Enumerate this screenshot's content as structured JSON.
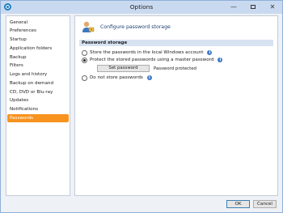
{
  "window": {
    "title": "Options",
    "minimize": "—",
    "close": "✕"
  },
  "sidebar": {
    "items": [
      {
        "label": "General"
      },
      {
        "label": "Preferences"
      },
      {
        "label": "Startup"
      },
      {
        "label": "Application folders"
      },
      {
        "label": "Backup"
      },
      {
        "label": "Filters"
      },
      {
        "label": "Logs and history"
      },
      {
        "label": "Backup on demand"
      },
      {
        "label": "CD, DVD or Blu-ray"
      },
      {
        "label": "Updates"
      },
      {
        "label": "Notifications"
      },
      {
        "label": "Passwords"
      }
    ],
    "selected": "Passwords"
  },
  "content": {
    "heading": "Configure password storage",
    "section_title": "Password storage",
    "options": [
      {
        "label": "Store the passwords in the local Windows account",
        "selected": false
      },
      {
        "label": "Protect the stored passwords using a master password",
        "selected": true
      },
      {
        "label": "Do not store passwords",
        "selected": false
      }
    ],
    "set_password_button": "Set password",
    "password_status": "Password protected",
    "info_glyph": "i"
  },
  "footer": {
    "ok": "OK",
    "cancel": "Cancel"
  },
  "colors": {
    "selection_accent": "#f8931f",
    "section_bar": "#d7e3f2",
    "titlebar": "#c9daf0"
  }
}
